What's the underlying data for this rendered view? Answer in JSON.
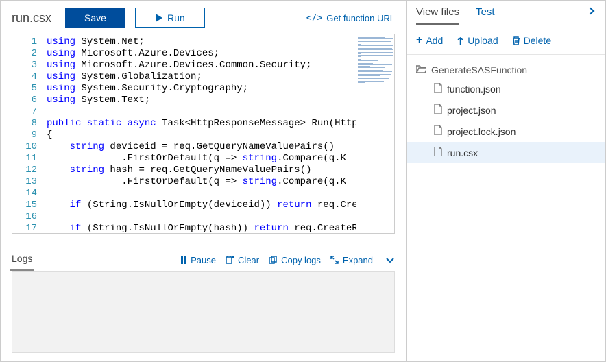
{
  "filename": "run.csx",
  "actions": {
    "save": "Save",
    "run": "Run",
    "get_url": "Get function URL"
  },
  "code": {
    "lines": [
      {
        "n": 1,
        "pre": "",
        "kw": "using",
        "rest": " System.Net;"
      },
      {
        "n": 2,
        "pre": "",
        "kw": "using",
        "rest": " Microsoft.Azure.Devices;"
      },
      {
        "n": 3,
        "pre": "",
        "kw": "using",
        "rest": " Microsoft.Azure.Devices.Common.Security;"
      },
      {
        "n": 4,
        "pre": "",
        "kw": "using",
        "rest": " System.Globalization;"
      },
      {
        "n": 5,
        "pre": "",
        "kw": "using",
        "rest": " System.Security.Cryptography;"
      },
      {
        "n": 6,
        "pre": "",
        "kw": "using",
        "rest": " System.Text;"
      },
      {
        "n": 7,
        "pre": "",
        "kw": "",
        "rest": ""
      },
      {
        "n": 8,
        "pre": "",
        "kw": "public static async",
        "rest": " Task<HttpResponseMessage> Run(HttpR"
      },
      {
        "n": 9,
        "pre": "{",
        "kw": "",
        "rest": ""
      },
      {
        "n": 10,
        "pre": "    ",
        "kw": "string",
        "rest": " deviceid = req.GetQueryNameValuePairs()"
      },
      {
        "n": 11,
        "pre": "             .FirstOrDefault(q => ",
        "kw": "string",
        "rest": ".Compare(q.K"
      },
      {
        "n": 12,
        "pre": "    ",
        "kw": "string",
        "rest": " hash = req.GetQueryNameValuePairs()"
      },
      {
        "n": 13,
        "pre": "             .FirstOrDefault(q => ",
        "kw": "string",
        "rest": ".Compare(q.K"
      },
      {
        "n": 14,
        "pre": "",
        "kw": "",
        "rest": ""
      },
      {
        "n": 15,
        "pre": "    ",
        "kw": "if",
        "rest": " (String.IsNullOrEmpty(deviceid)) ",
        "kw2": "return",
        "rest2": " req.Crea"
      },
      {
        "n": 16,
        "pre": "",
        "kw": "",
        "rest": ""
      },
      {
        "n": 17,
        "pre": "    ",
        "kw": "if",
        "rest": " (String.IsNullOrEmpty(hash)) ",
        "kw2": "return",
        "rest2": " req.CreateRe"
      }
    ]
  },
  "logs": {
    "title": "Logs",
    "pause": "Pause",
    "clear": "Clear",
    "copy": "Copy logs",
    "expand": "Expand"
  },
  "right": {
    "tabs": {
      "view": "View files",
      "test": "Test"
    },
    "actions": {
      "add": "Add",
      "upload": "Upload",
      "delete": "Delete"
    },
    "folder": "GenerateSASFunction",
    "files": [
      {
        "name": "function.json",
        "selected": false
      },
      {
        "name": "project.json",
        "selected": false
      },
      {
        "name": "project.lock.json",
        "selected": false
      },
      {
        "name": "run.csx",
        "selected": true
      }
    ]
  }
}
